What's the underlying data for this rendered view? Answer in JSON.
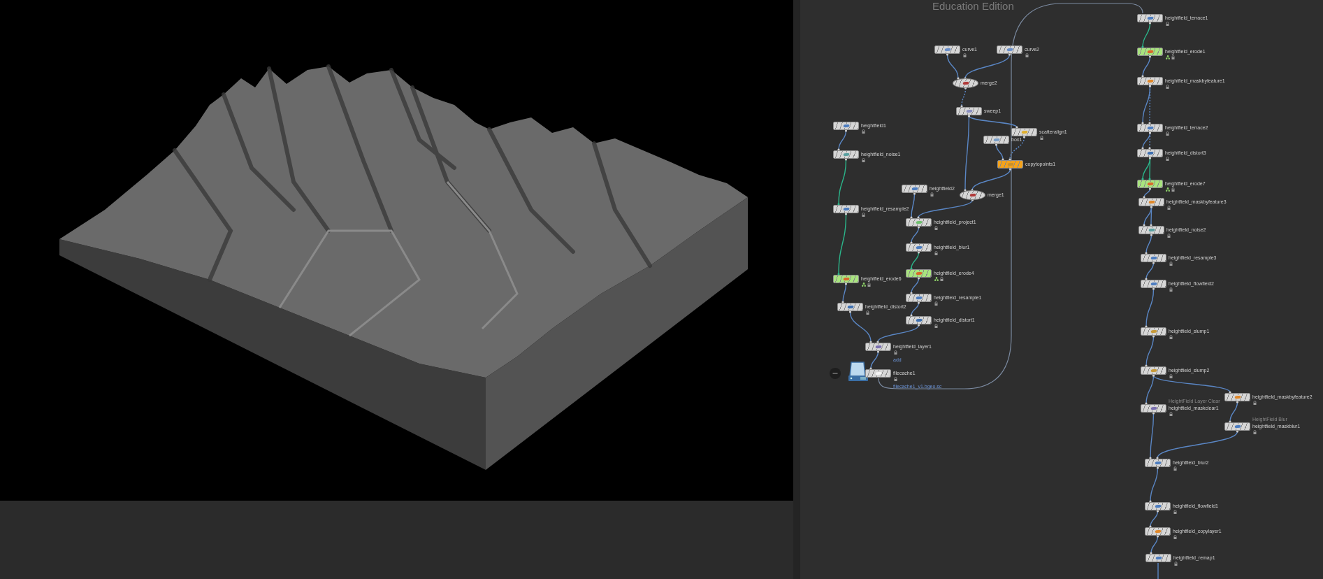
{
  "network": {
    "edition_label": "Education Edition",
    "nodes": [
      {
        "name": "curve1",
        "kind": "curve",
        "color": "#d6d6d6",
        "locked": true,
        "flagged": false
      },
      {
        "name": "curve2",
        "kind": "curve",
        "color": "#d6d6d6",
        "locked": true,
        "flagged": false
      },
      {
        "name": "merge2",
        "kind": "merge",
        "color": "#d6d6d6",
        "locked": false,
        "flagged": false
      },
      {
        "name": "sweep1",
        "kind": "sweep",
        "color": "#d6d6d6",
        "locked": false,
        "flagged": false
      },
      {
        "name": "heightfield1",
        "kind": "heightfield",
        "color": "#d6d6d6",
        "locked": true,
        "flagged": false
      },
      {
        "name": "heightfield_noise1",
        "kind": "noise",
        "color": "#d6d6d6",
        "locked": true,
        "flagged": false
      },
      {
        "name": "scatteralign1",
        "kind": "scatter",
        "color": "#d6d6d6",
        "locked": true,
        "flagged": false
      },
      {
        "name": "box1",
        "kind": "box",
        "color": "#d6d6d6",
        "locked": false,
        "flagged": false
      },
      {
        "name": "copytopoints1",
        "kind": "copy",
        "color": "#f5a31a",
        "locked": false,
        "flagged": false
      },
      {
        "name": "heightfield2",
        "kind": "heightfield",
        "color": "#d6d6d6",
        "locked": true,
        "flagged": false
      },
      {
        "name": "merge1",
        "kind": "merge",
        "color": "#d6d6d6",
        "locked": false,
        "flagged": false
      },
      {
        "name": "heightfield_resample2",
        "kind": "heightfield",
        "color": "#d6d6d6",
        "locked": true,
        "flagged": false
      },
      {
        "name": "heightfield_project1",
        "kind": "project",
        "color": "#d6d6d6",
        "locked": true,
        "flagged": false
      },
      {
        "name": "heightfield_blur1",
        "kind": "heightfield",
        "color": "#d6d6d6",
        "locked": true,
        "flagged": false
      },
      {
        "name": "heightfield_erode4",
        "kind": "erode",
        "color": "#a8e47e",
        "locked": true,
        "flagged": true
      },
      {
        "name": "heightfield_erode6",
        "kind": "erode",
        "color": "#a8e47e",
        "locked": true,
        "flagged": true
      },
      {
        "name": "heightfield_resample1",
        "kind": "heightfield",
        "color": "#d6d6d6",
        "locked": true,
        "flagged": false
      },
      {
        "name": "heightfield_distort2",
        "kind": "distort",
        "color": "#d6d6d6",
        "locked": true,
        "flagged": false
      },
      {
        "name": "heightfield_distort1",
        "kind": "distort",
        "color": "#d6d6d6",
        "locked": true,
        "flagged": false
      },
      {
        "name": "heightfield_layer1",
        "kind": "layer",
        "color": "#d6d6d6",
        "locked": true,
        "flagged": false,
        "sublabel": "add"
      },
      {
        "name": "filecache1",
        "kind": "filecache",
        "color": "#d6d6d6",
        "locked": true,
        "flagged": false,
        "sublabel": "filecache1_v1.bgeo.sc"
      },
      {
        "name": "heightfield_terrace1",
        "kind": "heightfield",
        "color": "#d6d6d6",
        "locked": true,
        "flagged": false
      },
      {
        "name": "heightfield_erode1",
        "kind": "erode",
        "color": "#a8e47e",
        "locked": true,
        "flagged": true
      },
      {
        "name": "heightfield_maskbyfeature1",
        "kind": "mask",
        "color": "#d6d6d6",
        "locked": true,
        "flagged": false
      },
      {
        "name": "heightfield_terrace2",
        "kind": "heightfield",
        "color": "#d6d6d6",
        "locked": true,
        "flagged": false
      },
      {
        "name": "heightfield_distort3",
        "kind": "distort",
        "color": "#d6d6d6",
        "locked": true,
        "flagged": false
      },
      {
        "name": "heightfield_erode7",
        "kind": "erode",
        "color": "#a8e47e",
        "locked": true,
        "flagged": true
      },
      {
        "name": "heightfield_maskbyfeature3",
        "kind": "mask",
        "color": "#d6d6d6",
        "locked": true,
        "flagged": false
      },
      {
        "name": "heightfield_noise2",
        "kind": "noise",
        "color": "#d6d6d6",
        "locked": true,
        "flagged": false
      },
      {
        "name": "heightfield_resample3",
        "kind": "heightfield",
        "color": "#d6d6d6",
        "locked": true,
        "flagged": false
      },
      {
        "name": "heightfield_flowfield2",
        "kind": "heightfield",
        "color": "#d6d6d6",
        "locked": true,
        "flagged": false
      },
      {
        "name": "heightfield_slump1",
        "kind": "slump",
        "color": "#d6d6d6",
        "locked": true,
        "flagged": false
      },
      {
        "name": "heightfield_slump2",
        "kind": "slump",
        "color": "#d6d6d6",
        "locked": true,
        "flagged": false
      },
      {
        "name": "heightfield_maskbyfeature2",
        "kind": "mask",
        "color": "#d6d6d6",
        "locked": true,
        "flagged": false
      },
      {
        "name": "heightfield_maskclear1",
        "kind": "layer",
        "color": "#d6d6d6",
        "locked": true,
        "flagged": false,
        "caption": "HeightField Layer Clear"
      },
      {
        "name": "heightfield_maskblur1",
        "kind": "heightfield",
        "color": "#d6d6d6",
        "locked": true,
        "flagged": false,
        "caption": "HeightField Blur"
      },
      {
        "name": "heightfield_blur2",
        "kind": "heightfield",
        "color": "#d6d6d6",
        "locked": true,
        "flagged": false
      },
      {
        "name": "heightfield_flowfield1",
        "kind": "heightfield",
        "color": "#d6d6d6",
        "locked": true,
        "flagged": false
      },
      {
        "name": "heightfield_copylayer1",
        "kind": "mask",
        "color": "#d6d6d6",
        "locked": true,
        "flagged": false
      },
      {
        "name": "heightfield_remap1",
        "kind": "heightfield",
        "color": "#d6d6d6",
        "locked": true,
        "flagged": false
      }
    ]
  }
}
